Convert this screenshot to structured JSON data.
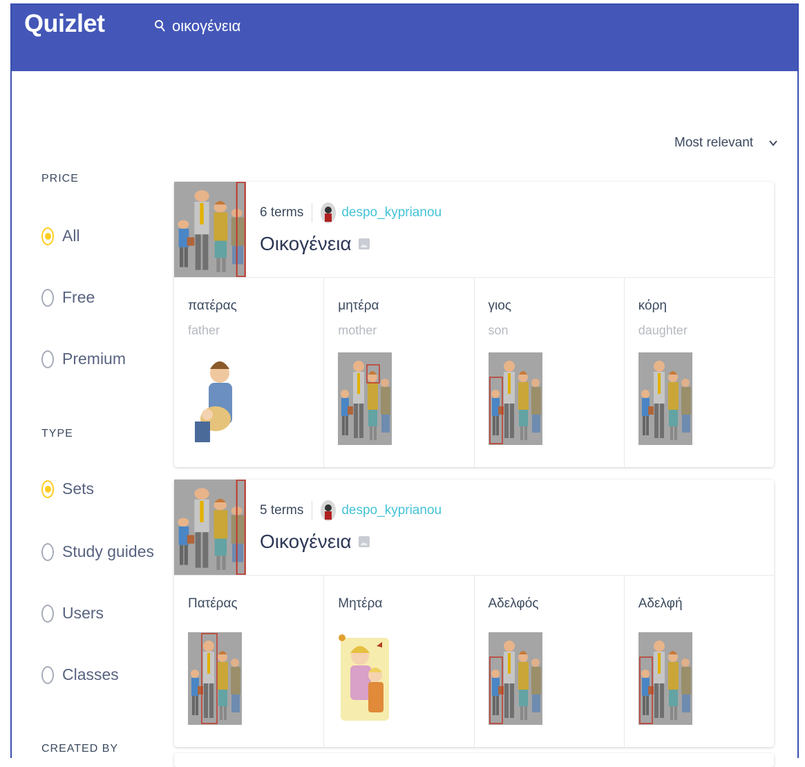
{
  "header": {
    "logo": "Quizlet",
    "search_value": "οικογένεια"
  },
  "sort": {
    "label": "Most relevant"
  },
  "filters": {
    "price": {
      "title": "PRICE",
      "options": [
        {
          "label": "All",
          "checked": true
        },
        {
          "label": "Free",
          "checked": false
        },
        {
          "label": "Premium",
          "checked": false
        }
      ]
    },
    "type": {
      "title": "TYPE",
      "options": [
        {
          "label": "Sets",
          "checked": true
        },
        {
          "label": "Study guides",
          "checked": false
        },
        {
          "label": "Users",
          "checked": false
        },
        {
          "label": "Classes",
          "checked": false
        }
      ]
    },
    "created_by": {
      "title": "CREATED BY"
    }
  },
  "results": [
    {
      "term_count": "6 terms",
      "username": "despo_kyprianou",
      "title": "Οικογένεια",
      "terms": [
        {
          "word": "πατέρας",
          "definition": "father",
          "image": "father-holding-baby"
        },
        {
          "word": "μητέρα",
          "definition": "mother",
          "image": "family-group-mother-highlighted"
        },
        {
          "word": "γιος",
          "definition": "son",
          "image": "family-group-son-highlighted"
        },
        {
          "word": "κόρη",
          "definition": "daughter",
          "image": "family-group"
        }
      ]
    },
    {
      "term_count": "5 terms",
      "username": "despo_kyprianou",
      "title": "Οικογένεια",
      "terms": [
        {
          "word": "Πατέρας",
          "definition": "",
          "image": "family-group-father-highlighted"
        },
        {
          "word": "Μητέρα",
          "definition": "",
          "image": "mother-and-child"
        },
        {
          "word": "Αδελφός",
          "definition": "",
          "image": "family-group-brother-highlighted"
        },
        {
          "word": "Αδελφή",
          "definition": "",
          "image": "family-group-sister-highlighted"
        }
      ]
    }
  ]
}
